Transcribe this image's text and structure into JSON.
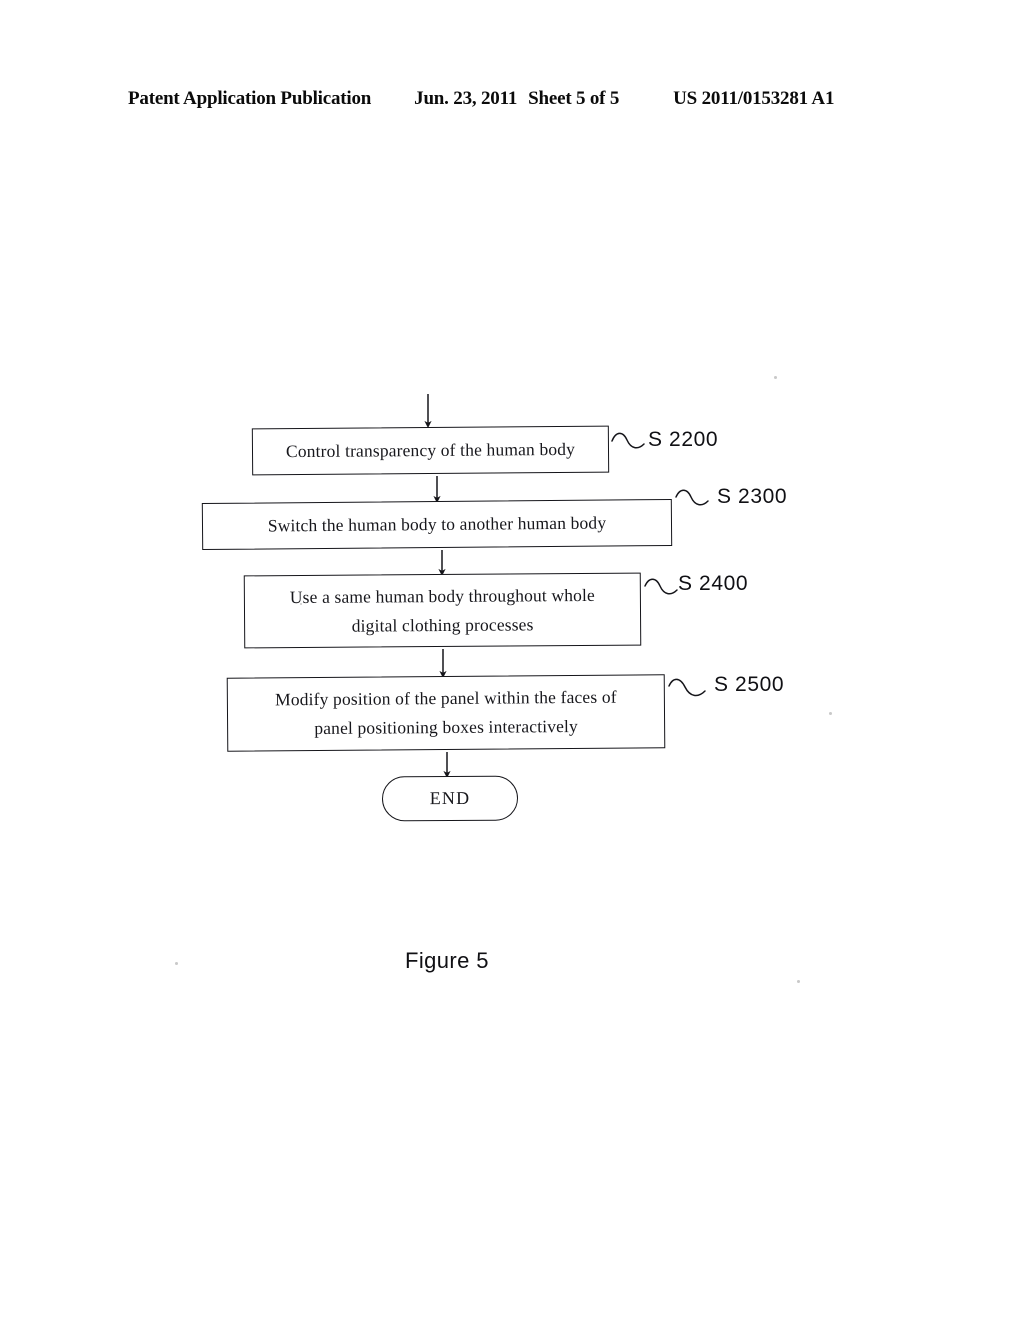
{
  "header": {
    "publication": "Patent Application Publication",
    "date": "Jun. 23, 2011",
    "sheet": "Sheet 5 of 5",
    "document_number": "US 2011/0153281 A1"
  },
  "figure": {
    "caption": "Figure 5",
    "terminator_label": "END"
  },
  "flowchart": {
    "type": "flowchart",
    "orientation": "top-to-bottom",
    "entry_arrow": "incoming arrow from previous sheet",
    "steps": [
      {
        "id": "S 2200",
        "text": "Control transparency of the human body",
        "shape": "process"
      },
      {
        "id": "S 2300",
        "text": "Switch the human body to another human body",
        "shape": "process"
      },
      {
        "id": "S 2400",
        "text": "Use a same human body throughout whole digital clothing processes",
        "line1": "Use a same human body throughout whole",
        "line2": "digital clothing processes",
        "shape": "process"
      },
      {
        "id": "S 2500",
        "text": "Modify position of the panel within the faces of panel positioning boxes interactively",
        "line1": "Modify position of the panel within the faces of",
        "line2": "panel positioning boxes interactively",
        "shape": "process"
      },
      {
        "id": "END",
        "text": "END",
        "shape": "terminator"
      }
    ]
  },
  "colors": {
    "page_background": "#ffffff",
    "ink": "#15151a",
    "text": "#17171c"
  }
}
